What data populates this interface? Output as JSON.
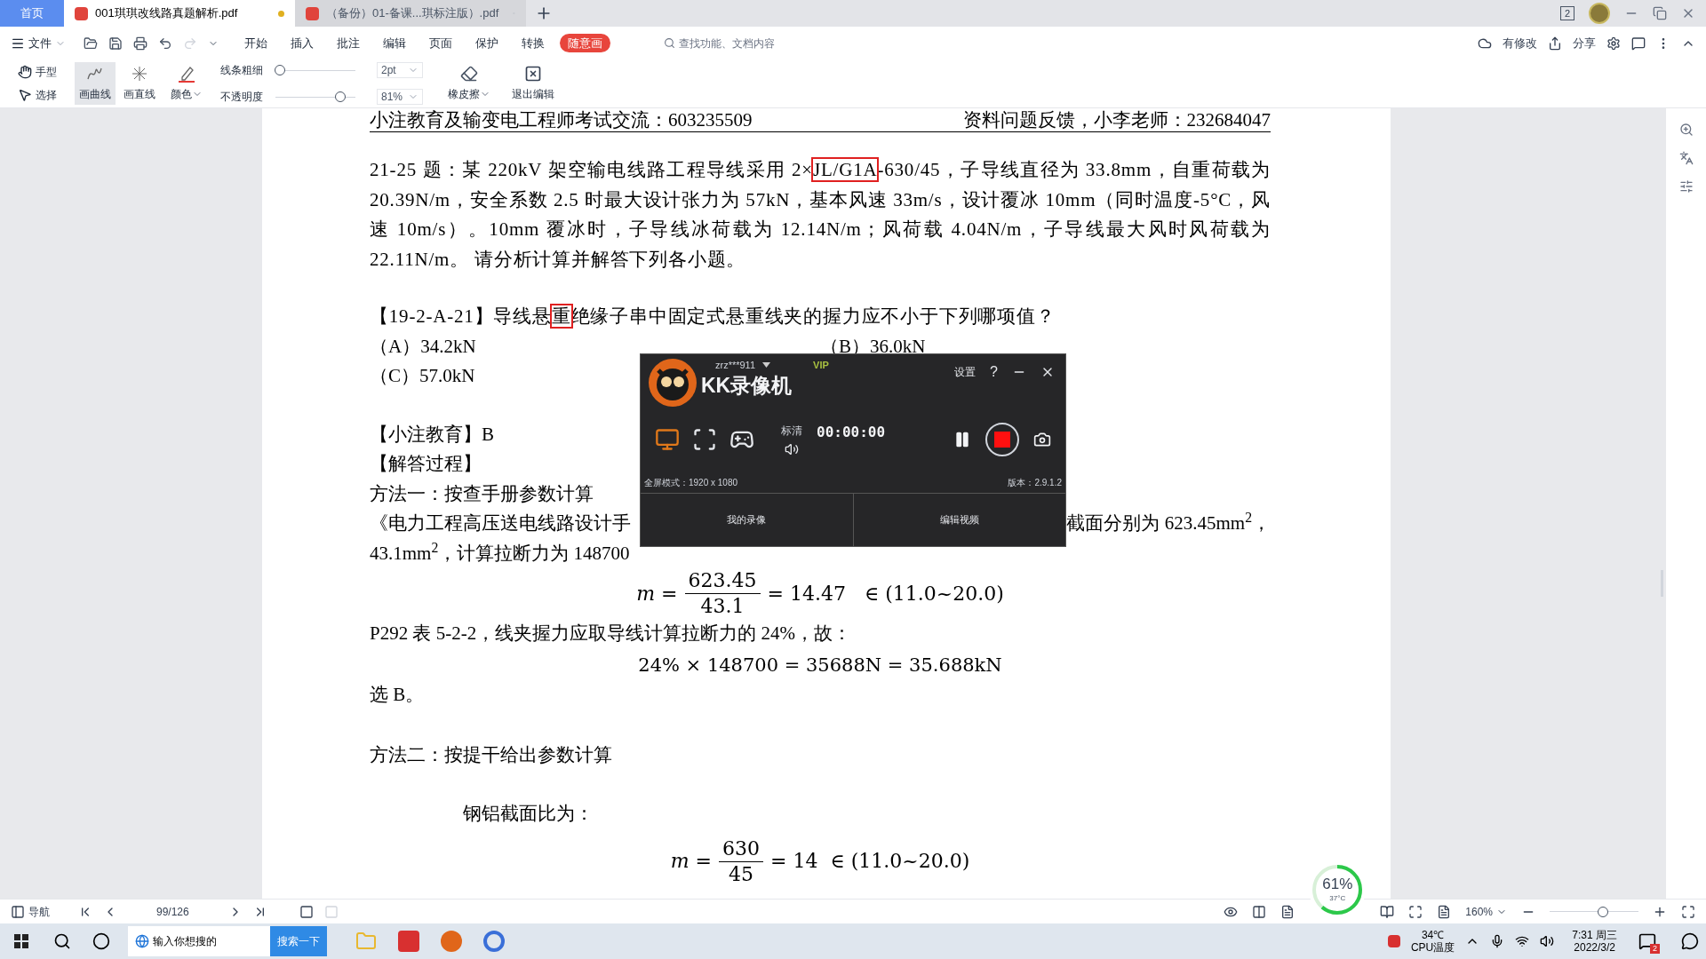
{
  "tabs": [
    {
      "kind": "home",
      "label": "首页",
      "selected": false
    },
    {
      "kind": "file",
      "label": "001琪琪改线路真题解析.pdf",
      "selected": true,
      "modified": true
    },
    {
      "kind": "file",
      "label": "（备份）01-备课...琪标注版）.pdf",
      "selected": false,
      "modified": false
    }
  ],
  "title_bar": {
    "badge": "2"
  },
  "menu": {
    "file": "文件",
    "items": [
      {
        "label": "开始",
        "selected": false
      },
      {
        "label": "插入",
        "selected": false
      },
      {
        "label": "批注",
        "selected": false
      },
      {
        "label": "编辑",
        "selected": false
      },
      {
        "label": "页面",
        "selected": false
      },
      {
        "label": "保护",
        "selected": false
      },
      {
        "label": "转换",
        "selected": false
      },
      {
        "label": "随意画",
        "selected": true
      }
    ],
    "search": {
      "placeholder": "查找功能、文档内容"
    },
    "actions": [
      "有修改",
      "分享"
    ]
  },
  "toolbar": {
    "modes": [
      "手型",
      "选择"
    ],
    "draw": [
      {
        "label": "画曲线",
        "selected": true
      },
      {
        "label": "画直线",
        "selected": false
      }
    ],
    "color_label": "颜色",
    "sliders": [
      {
        "label": "线条粗细",
        "level": 0.05,
        "value": "2pt"
      },
      {
        "label": "不透明度",
        "level": 0.81,
        "value": "81%"
      }
    ],
    "eraser": "橡皮擦",
    "exit": "退出编辑"
  },
  "document": {
    "header_left": "小注教育及输变电工程师考试交流：603235509",
    "header_right": "资料问题反馈，小李老师：232684047",
    "blocks": [
      {
        "kind": "text",
        "parts": [
          {
            "text": "21-25 题：某 220kV 架空输电线路工程导线采用 2×",
            "boxed": false
          },
          {
            "text": "JL/G1A",
            "boxed": true
          },
          {
            "text": "-630/45，子导线直径为 33.8mm，自重荷载为 20.39N/m，安全系数 2.5 时最大设计张力为 57kN，基本风速 33m/s，设计覆冰 10mm（同时温度-5°C，风速 10m/s）。10mm 覆冰时，子导线冰荷载为 12.14N/m；风荷载 4.04N/m，子导线最大风时风荷载为 22.11N/m。 请分析计算并解答下列各小题。",
            "boxed": false
          }
        ]
      },
      {
        "kind": "text",
        "parts": [
          {
            "text": "【19-2-A-21】导线悬",
            "boxed": false
          },
          {
            "text": "重",
            "boxed": true
          },
          {
            "text": "绝缘子串中固定式悬重线夹的握力应不小于下列哪项值？",
            "boxed": false
          }
        ]
      },
      {
        "kind": "options",
        "items": [
          "（A）34.2kN",
          "（B）36.0kN",
          "（C）57.0kN"
        ]
      },
      {
        "kind": "text",
        "parts": [
          {
            "text": "【小注教育】B",
            "boxed": false
          }
        ]
      },
      {
        "kind": "text",
        "parts": [
          {
            "text": "【解答过程】",
            "boxed": false
          }
        ]
      },
      {
        "kind": "text",
        "parts": [
          {
            "text": "方法一：按查手册参数计算",
            "boxed": false
          }
        ]
      },
      {
        "kind": "split",
        "left": "《电力工程高压送电线路设计手",
        "right": "截面分别为 623.45mm$^{2}$，"
      },
      {
        "kind": "text",
        "parts": [
          {
            "text": "43.1mm$^{2}$，计算拉断力为 148700",
            "boxed": false
          }
        ]
      },
      {
        "kind": "fraction",
        "lhs": "m =",
        "num": "623.45",
        "den": "43.1",
        "rhs": "= 14.47   ∈ (11.0~20.0)"
      },
      {
        "kind": "text",
        "parts": [
          {
            "text": "P292  表 5-2-2，线夹握力应取导线计算拉断力的 24%，故：",
            "boxed": false
          }
        ]
      },
      {
        "kind": "formula",
        "text": "24% × 148700 = 35688N = 35.688kN"
      },
      {
        "kind": "text",
        "parts": [
          {
            "text": "选 B。",
            "boxed": false
          }
        ]
      },
      {
        "kind": "text",
        "parts": [
          {
            "text": "方法二：按提干给出参数计算",
            "boxed": false
          }
        ]
      },
      {
        "kind": "indented",
        "text": "钢铝截面比为："
      },
      {
        "kind": "fraction",
        "lhs": "m =",
        "num": "630",
        "den": "45",
        "rhs": "= 14  ∈ (11.0~20.0)"
      }
    ]
  },
  "recorder": {
    "user": "zrz***911",
    "vip": "VIP",
    "settings": "设置",
    "help": "?",
    "title": "KK录像机",
    "modes": [
      {
        "kind": "fullscreen",
        "selected": true
      },
      {
        "kind": "region",
        "selected": false
      },
      {
        "kind": "game",
        "selected": false
      }
    ],
    "quality": "标清",
    "timer": "00:00:00",
    "mode_info": "全屏模式：1920 x 1080",
    "version": "版本：2.9.1.2",
    "buttons": [
      "我的录像",
      "编辑视频"
    ]
  },
  "status_bar": {
    "nav": "导航",
    "page": "99/126",
    "zoom": "160%",
    "zoom_slider": {
      "level": 0.6
    }
  },
  "monitor": {
    "value": "61%",
    "temp": "37°C",
    "level": 0.61
  },
  "taskbar": {
    "search_placeholder": "输入你想搜的",
    "search_button": "搜索一下",
    "temp": "34℃",
    "temp_label": "CPU温度",
    "time": "7:31 周三",
    "date": "2022/3/2",
    "notifications": "2"
  }
}
